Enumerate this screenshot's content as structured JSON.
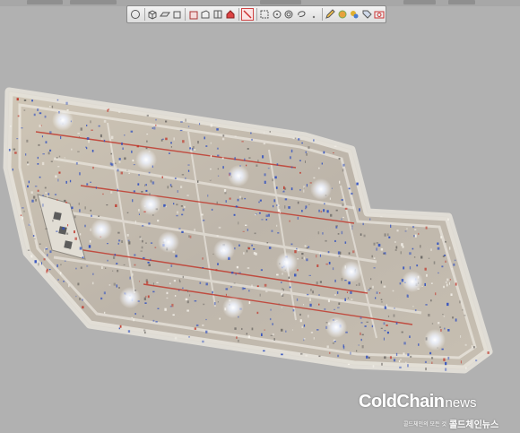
{
  "toolbar": {
    "buttons": [
      {
        "icon": "sphere-icon",
        "active": false
      },
      {
        "icon": "cube-icon",
        "active": false
      },
      {
        "icon": "plane-icon",
        "active": false
      },
      {
        "icon": "box-icon",
        "active": false
      },
      {
        "icon": "front-view-icon",
        "active": false
      },
      {
        "icon": "side-view-icon",
        "active": false
      },
      {
        "icon": "split-view-icon",
        "active": false
      },
      {
        "icon": "house-icon",
        "active": false
      },
      {
        "icon": "diagonal-cut-icon",
        "active": true
      },
      {
        "icon": "rectangle-select-icon",
        "active": false
      },
      {
        "icon": "circle-dot-icon",
        "active": false
      },
      {
        "icon": "target-icon",
        "active": false
      },
      {
        "icon": "lasso-icon",
        "active": false
      },
      {
        "icon": "small-dot-icon",
        "active": false
      },
      {
        "icon": "pencil-icon",
        "active": false
      },
      {
        "icon": "color-picker-icon",
        "active": false
      },
      {
        "icon": "paint-icon",
        "active": false
      },
      {
        "icon": "tag-icon",
        "active": false
      },
      {
        "icon": "camera-icon",
        "active": false
      }
    ]
  },
  "watermark": {
    "brand": "ColdChain",
    "suffix": "news",
    "tagline": "콜드체인의 모든 것",
    "korean_brand": "콜드체인뉴스"
  },
  "colors": {
    "background": "#b1b1b1",
    "toolbar_active": "#d04545",
    "cloud_blue": "#2f4fbf",
    "cloud_red": "#c03a2e"
  }
}
